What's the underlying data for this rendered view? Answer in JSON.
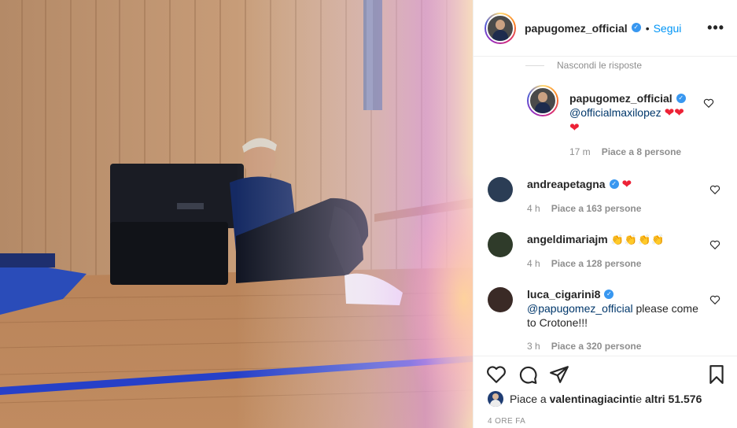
{
  "post": {
    "author": "papugomez_official",
    "follow_label": "Segui",
    "more_label": "•••",
    "hide_replies_label": "Nascondi le risposte"
  },
  "reply": {
    "user": "papugomez_official",
    "mention": "@officialmaxilopez",
    "emoji": "❤❤",
    "emoji_line2": "❤",
    "time": "17 m",
    "likes": "Piace a 8 persone"
  },
  "comments": [
    {
      "user": "andreapetagna",
      "emoji": "❤",
      "time": "4 h",
      "likes": "Piace a 163 persone"
    },
    {
      "user": "angeldimariajm",
      "emoji": "👏👏👏👏",
      "time": "4 h",
      "likes": "Piace a 128 persone"
    },
    {
      "user": "luca_cigarini8",
      "mention": "@papugomez_official",
      "text": " please come",
      "text2": "to Crotone!!!",
      "time": "3 h",
      "likes": "Piace a 320 persone"
    }
  ],
  "likes_summary": {
    "prefix": "Piace a ",
    "user": "valentinagiacinti",
    "middle": " e ",
    "rest": "altri 51.576"
  },
  "time_ago": "4 ORE FA",
  "colors": {
    "link_blue": "#0095f6",
    "verified": "#3897f0",
    "heart": "#ed2236"
  },
  "icons": [
    "like-icon",
    "comment-icon",
    "share-icon",
    "save-icon",
    "verified-icon",
    "more-icon"
  ]
}
